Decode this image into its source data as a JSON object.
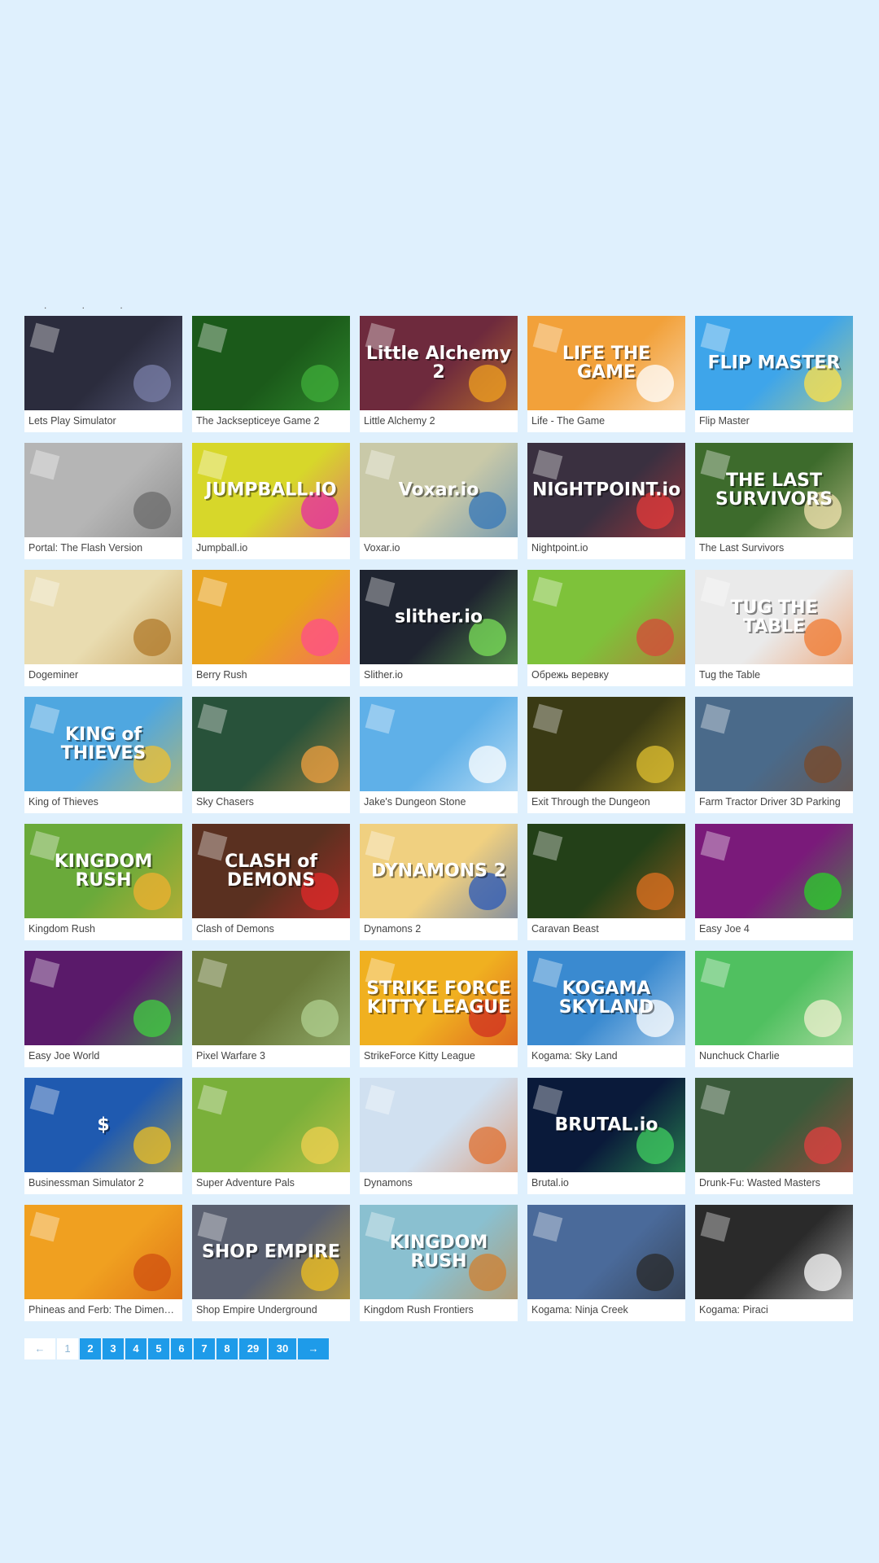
{
  "section": {
    "heading": ". . ."
  },
  "games": [
    {
      "title": "Lets Play Simulator",
      "thumb_label": "",
      "bg": "#2b2c3d",
      "accent": "#7a7fa8"
    },
    {
      "title": "The Jacksepticeye Game 2",
      "thumb_label": "",
      "bg": "#1b5a1a",
      "accent": "#3fae3a"
    },
    {
      "title": "Little Alchemy 2",
      "thumb_label": "Little Alchemy 2",
      "bg": "#6e2a3d",
      "accent": "#f0a020"
    },
    {
      "title": "Life - The Game",
      "thumb_label": "LIFE THE GAME",
      "bg": "#f2a13a",
      "accent": "#ffffff"
    },
    {
      "title": "Flip Master",
      "thumb_label": "FLIP MASTER",
      "bg": "#3ea5ea",
      "accent": "#ffe24a"
    },
    {
      "title": "Portal: The Flash Version",
      "thumb_label": "",
      "bg": "#b5b5b5",
      "accent": "#6b6b6b"
    },
    {
      "title": "Jumpball.io",
      "thumb_label": "JUMPBALL.IO",
      "bg": "#d7d72a",
      "accent": "#e52ca0"
    },
    {
      "title": "Voxar.io",
      "thumb_label": "Voxar.io",
      "bg": "#c9c9a8",
      "accent": "#3577b8"
    },
    {
      "title": "Nightpoint.io",
      "thumb_label": "NIGHTPOINT.io",
      "bg": "#3a3040",
      "accent": "#e63a3a"
    },
    {
      "title": "The Last Survivors",
      "thumb_label": "THE LAST SURVIVORS",
      "bg": "#3d6b2c",
      "accent": "#f3e3b0"
    },
    {
      "title": "Dogeminer",
      "thumb_label": "",
      "bg": "#e9dcb0",
      "accent": "#b07a2a"
    },
    {
      "title": "Berry Rush",
      "thumb_label": "",
      "bg": "#e8a21c",
      "accent": "#ff4d8a"
    },
    {
      "title": "Slither.io",
      "thumb_label": "slither.io",
      "bg": "#1f2430",
      "accent": "#7be05a"
    },
    {
      "title": "Обрежь веревку",
      "thumb_label": "",
      "bg": "#7ec23a",
      "accent": "#d6493a"
    },
    {
      "title": "Tug the Table",
      "thumb_label": "TUG THE TABLE",
      "bg": "#eaeaea",
      "accent": "#f07a30"
    },
    {
      "title": "King of Thieves",
      "thumb_label": "KING of THIEVES",
      "bg": "#4fa7e0",
      "accent": "#f0c030"
    },
    {
      "title": "Sky Chasers",
      "thumb_label": "",
      "bg": "#28523a",
      "accent": "#f0a040"
    },
    {
      "title": "Jake's Dungeon Stone",
      "thumb_label": "",
      "bg": "#5fb0e8",
      "accent": "#ffffff"
    },
    {
      "title": "Exit Through the Dungeon",
      "thumb_label": "",
      "bg": "#3a3a14",
      "accent": "#e0c030"
    },
    {
      "title": "Farm Tractor Driver 3D Parking",
      "thumb_label": "",
      "bg": "#4a6a8a",
      "accent": "#7a4a2a"
    },
    {
      "title": "Kingdom Rush",
      "thumb_label": "KINGDOM RUSH",
      "bg": "#6aaa3a",
      "accent": "#f0b030"
    },
    {
      "title": "Clash of Demons",
      "thumb_label": "CLASH of DEMONS",
      "bg": "#5a3020",
      "accent": "#e02a2a"
    },
    {
      "title": "Dynamons 2",
      "thumb_label": "DYNAMONS 2",
      "bg": "#f0d080",
      "accent": "#2a58b8"
    },
    {
      "title": "Caravan Beast",
      "thumb_label": "",
      "bg": "#234018",
      "accent": "#e07020"
    },
    {
      "title": "Easy Joe 4",
      "thumb_label": "",
      "bg": "#7a1a7a",
      "accent": "#2ad02a"
    },
    {
      "title": "Easy Joe World",
      "thumb_label": "",
      "bg": "#5a1a6a",
      "accent": "#40d040"
    },
    {
      "title": "Pixel Warfare 3",
      "thumb_label": "",
      "bg": "#6a7a3a",
      "accent": "#b0d090"
    },
    {
      "title": "StrikeForce Kitty League",
      "thumb_label": "STRIKE FORCE KITTY LEAGUE",
      "bg": "#f0b020",
      "accent": "#d03020"
    },
    {
      "title": "Kogama: Sky Land",
      "thumb_label": "KOGAMA SKYLAND",
      "bg": "#3a8ad0",
      "accent": "#ffffff"
    },
    {
      "title": "Nunchuck Charlie",
      "thumb_label": "",
      "bg": "#50c060",
      "accent": "#f0f0d0"
    },
    {
      "title": "Businessman Simulator 2",
      "thumb_label": "$",
      "bg": "#1f5ab0",
      "accent": "#f0c020"
    },
    {
      "title": "Super Adventure Pals",
      "thumb_label": "",
      "bg": "#7ab03a",
      "accent": "#f0d050"
    },
    {
      "title": "Dynamons",
      "thumb_label": "",
      "bg": "#d0e0f0",
      "accent": "#e07030"
    },
    {
      "title": "Brutal.io",
      "thumb_label": "BRUTAL.io",
      "bg": "#0a1a3a",
      "accent": "#40d060"
    },
    {
      "title": "Drunk-Fu: Wasted Masters",
      "thumb_label": "",
      "bg": "#3a5a3a",
      "accent": "#e04040"
    },
    {
      "title": "Phineas and Ferb: The Dimension",
      "thumb_label": "",
      "bg": "#f0a020",
      "accent": "#d05010"
    },
    {
      "title": "Shop Empire Underground",
      "thumb_label": "SHOP EMPIRE",
      "bg": "#5a6070",
      "accent": "#f0c020"
    },
    {
      "title": "Kingdom Rush Frontiers",
      "thumb_label": "KINGDOM RUSH",
      "bg": "#8ac0d0",
      "accent": "#d08030"
    },
    {
      "title": "Kogama: Ninja Creek",
      "thumb_label": "",
      "bg": "#4a6a9a",
      "accent": "#2a2a2a"
    },
    {
      "title": "Kogama: Piraci",
      "thumb_label": "",
      "bg": "#2a2a2a",
      "accent": "#ffffff"
    }
  ],
  "pagination": {
    "prev": "←",
    "pages": [
      "1",
      "2",
      "3",
      "4",
      "5",
      "6",
      "7",
      "8",
      "29",
      "30"
    ],
    "current": "1",
    "next": "→"
  },
  "colors": {
    "background": "#dff0fd",
    "pager_active": "#1e9be9"
  }
}
